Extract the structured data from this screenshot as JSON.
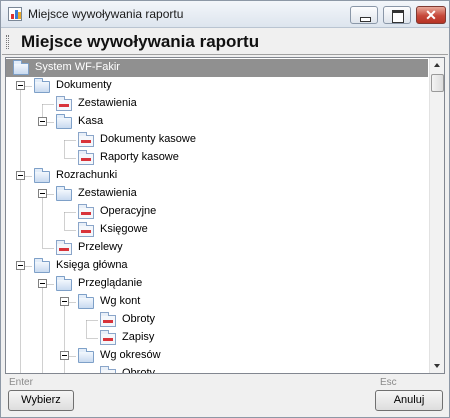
{
  "window": {
    "title": "Miejsce wywoływania raportu"
  },
  "header": {
    "title": "Miejsce wywoływania raportu"
  },
  "tree": {
    "rows": [
      {
        "label": "System WF-Fakir",
        "depth": 0,
        "type": "folder",
        "expander": false,
        "selected": true
      },
      {
        "label": "Dokumenty",
        "depth": 0,
        "type": "folder",
        "expander": true
      },
      {
        "label": "Zestawienia",
        "depth": 1,
        "type": "report",
        "expander": false
      },
      {
        "label": "Kasa",
        "depth": 1,
        "type": "folder",
        "expander": true
      },
      {
        "label": "Dokumenty kasowe",
        "depth": 2,
        "type": "report",
        "expander": false
      },
      {
        "label": "Raporty kasowe",
        "depth": 2,
        "type": "report",
        "expander": false
      },
      {
        "label": "Rozrachunki",
        "depth": 0,
        "type": "folder",
        "expander": true
      },
      {
        "label": "Zestawienia",
        "depth": 1,
        "type": "folder",
        "expander": true
      },
      {
        "label": "Operacyjne",
        "depth": 2,
        "type": "report",
        "expander": false
      },
      {
        "label": "Księgowe",
        "depth": 2,
        "type": "report",
        "expander": false
      },
      {
        "label": "Przelewy",
        "depth": 1,
        "type": "report",
        "expander": false
      },
      {
        "label": "Księga główna",
        "depth": 0,
        "type": "folder",
        "expander": true
      },
      {
        "label": "Przeglądanie",
        "depth": 1,
        "type": "folder",
        "expander": true
      },
      {
        "label": "Wg kont",
        "depth": 2,
        "type": "folder",
        "expander": true
      },
      {
        "label": "Obroty",
        "depth": 3,
        "type": "report",
        "expander": false
      },
      {
        "label": "Zapisy",
        "depth": 3,
        "type": "report",
        "expander": false
      },
      {
        "label": "Wg okresów",
        "depth": 2,
        "type": "folder",
        "expander": true
      },
      {
        "label": "Obroty",
        "depth": 3,
        "type": "report",
        "expander": false
      }
    ]
  },
  "footer": {
    "enter_hint": "Enter",
    "esc_hint": "Esc",
    "select_button": "Wybierz",
    "cancel_button": "Anuluj"
  },
  "colors": {
    "selection": "#909090",
    "report_mark": "#d8333a",
    "folder_border": "#7ea0c8"
  }
}
